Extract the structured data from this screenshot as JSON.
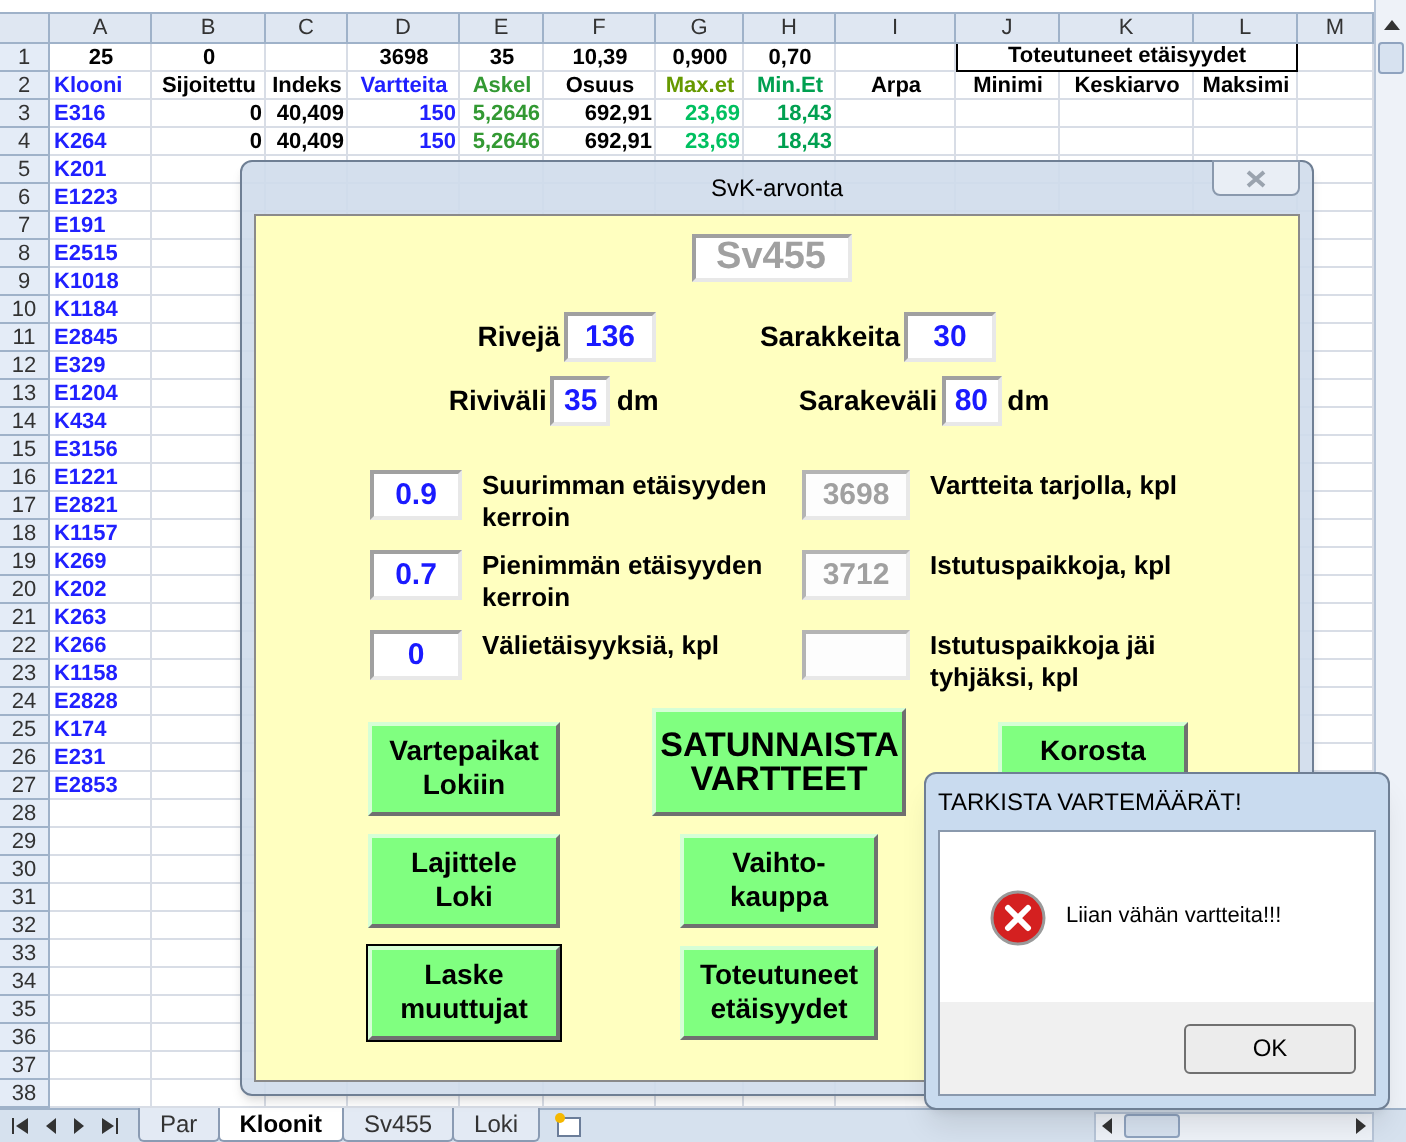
{
  "sheet": {
    "column_headers": [
      "A",
      "B",
      "C",
      "D",
      "E",
      "F",
      "G",
      "H",
      "I",
      "J",
      "K",
      "L",
      "M"
    ],
    "rows": [
      {
        "number": "1",
        "cells": [
          {
            "text": "25",
            "color": "#000000"
          },
          {
            "text": "0",
            "color": "#000000"
          },
          null,
          {
            "text": "3698",
            "color": "#000000"
          },
          {
            "text": "35",
            "color": "#000000"
          },
          {
            "text": "10,39",
            "color": "#000000"
          },
          {
            "text": "0,900",
            "color": "#000000"
          },
          {
            "text": "0,70",
            "color": "#000000"
          },
          null
        ],
        "merged_cell": "Toteutuneet etäisyydet"
      },
      {
        "number": "2",
        "cells": [
          {
            "text": "Klooni",
            "color": "#2020ff"
          },
          {
            "text": "Sijoitettu",
            "color": "#000000"
          },
          {
            "text": "Indeks",
            "color": "#000000"
          },
          {
            "text": "Vartteita",
            "color": "#2020ff"
          },
          {
            "text": "Askel",
            "color": "#339933"
          },
          {
            "text": "Osuus",
            "color": "#000000"
          },
          {
            "text": "Max.et",
            "color": "#669900"
          },
          {
            "text": "Min.Et",
            "color": "#00a050"
          },
          {
            "text": "Arpa",
            "color": "#000000"
          },
          {
            "text": "Minimi",
            "color": "#000000"
          },
          {
            "text": "Keskiarvo",
            "color": "#000000"
          },
          {
            "text": "Maksimi",
            "color": "#000000"
          }
        ]
      },
      {
        "number": "3",
        "cells": [
          {
            "text": "E316",
            "color": "#2020ff"
          },
          {
            "text": "0",
            "color": "#000000"
          },
          {
            "text": "40,409",
            "color": "#000000"
          },
          {
            "text": "150",
            "color": "#2020ff"
          },
          {
            "text": "5,2646",
            "color": "#339933"
          },
          {
            "text": "692,91",
            "color": "#000000"
          },
          {
            "text": "23,69",
            "color": "#00c060"
          },
          {
            "text": "18,43",
            "color": "#00a050"
          }
        ]
      },
      {
        "number": "4",
        "cells": [
          {
            "text": "K264",
            "color": "#2020ff"
          },
          {
            "text": "0",
            "color": "#000000"
          },
          {
            "text": "40,409",
            "color": "#000000"
          },
          {
            "text": "150",
            "color": "#2020ff"
          },
          {
            "text": "5,2646",
            "color": "#339933"
          },
          {
            "text": "692,91",
            "color": "#000000"
          },
          {
            "text": "23,69",
            "color": "#00c060"
          },
          {
            "text": "18,43",
            "color": "#00a050"
          }
        ]
      },
      {
        "number": "5",
        "cells": [
          {
            "text": "K201",
            "color": "#2020ff"
          }
        ]
      },
      {
        "number": "6",
        "cells": [
          {
            "text": "E1223",
            "color": "#2020ff"
          }
        ]
      },
      {
        "number": "7",
        "cells": [
          {
            "text": "E191",
            "color": "#2020ff"
          }
        ]
      },
      {
        "number": "8",
        "cells": [
          {
            "text": "E2515",
            "color": "#2020ff"
          }
        ]
      },
      {
        "number": "9",
        "cells": [
          {
            "text": "K1018",
            "color": "#2020ff"
          }
        ]
      },
      {
        "number": "10",
        "cells": [
          {
            "text": "K1184",
            "color": "#2020ff"
          }
        ]
      },
      {
        "number": "11",
        "cells": [
          {
            "text": "E2845",
            "color": "#2020ff"
          }
        ]
      },
      {
        "number": "12",
        "cells": [
          {
            "text": "E329",
            "color": "#2020ff"
          }
        ]
      },
      {
        "number": "13",
        "cells": [
          {
            "text": "E1204",
            "color": "#2020ff"
          }
        ]
      },
      {
        "number": "14",
        "cells": [
          {
            "text": "K434",
            "color": "#2020ff"
          }
        ]
      },
      {
        "number": "15",
        "cells": [
          {
            "text": "E3156",
            "color": "#2020ff"
          }
        ]
      },
      {
        "number": "16",
        "cells": [
          {
            "text": "E1221",
            "color": "#2020ff"
          }
        ]
      },
      {
        "number": "17",
        "cells": [
          {
            "text": "E2821",
            "color": "#2020ff"
          }
        ]
      },
      {
        "number": "18",
        "cells": [
          {
            "text": "K1157",
            "color": "#2020ff"
          }
        ]
      },
      {
        "number": "19",
        "cells": [
          {
            "text": "K269",
            "color": "#2020ff"
          }
        ]
      },
      {
        "number": "20",
        "cells": [
          {
            "text": "K202",
            "color": "#2020ff"
          }
        ]
      },
      {
        "number": "21",
        "cells": [
          {
            "text": "K263",
            "color": "#2020ff"
          }
        ]
      },
      {
        "number": "22",
        "cells": [
          {
            "text": "K266",
            "color": "#2020ff"
          }
        ]
      },
      {
        "number": "23",
        "cells": [
          {
            "text": "K1158",
            "color": "#2020ff"
          }
        ]
      },
      {
        "number": "24",
        "cells": [
          {
            "text": "E2828",
            "color": "#2020ff"
          }
        ]
      },
      {
        "number": "25",
        "cells": [
          {
            "text": "K174",
            "color": "#2020ff"
          }
        ]
      },
      {
        "number": "26",
        "cells": [
          {
            "text": "E231",
            "color": "#2020ff"
          }
        ]
      },
      {
        "number": "27",
        "cells": [
          {
            "text": "E2853",
            "color": "#2020ff"
          }
        ]
      },
      {
        "number": "28",
        "cells": []
      },
      {
        "number": "29",
        "cells": []
      },
      {
        "number": "30",
        "cells": []
      },
      {
        "number": "31",
        "cells": []
      },
      {
        "number": "32",
        "cells": []
      },
      {
        "number": "33",
        "cells": []
      },
      {
        "number": "34",
        "cells": []
      },
      {
        "number": "35",
        "cells": []
      },
      {
        "number": "36",
        "cells": []
      },
      {
        "number": "37",
        "cells": []
      },
      {
        "number": "38",
        "cells": []
      }
    ],
    "tabs": [
      {
        "label": "Par",
        "selected": false
      },
      {
        "label": "Kloonit",
        "selected": true
      },
      {
        "label": "Sv455",
        "selected": false
      },
      {
        "label": "Loki",
        "selected": false
      }
    ]
  },
  "dialog": {
    "title": "SvK-arvonta",
    "sheet_name": "Sv455",
    "grid_fields": [
      {
        "label": "Rivejä",
        "value": "136"
      },
      {
        "label": "Sarakkeita",
        "value": "30"
      },
      {
        "label": "Riviväli",
        "value": "35",
        "unit": "dm"
      },
      {
        "label": "Sarakeväli",
        "value": "80",
        "unit": "dm"
      }
    ],
    "factor_rows": [
      [
        {
          "value": "0.9",
          "label": "Suurimman etäisyyden kerroin",
          "disabled": false
        },
        {
          "value": "3698",
          "label": "Vartteita tarjolla, kpl",
          "disabled": true
        }
      ],
      [
        {
          "value": "0.7",
          "label": "Pienimmän etäisyyden kerroin",
          "disabled": false
        },
        {
          "value": "3712",
          "label": "Istutuspaikkoja, kpl",
          "disabled": true
        }
      ],
      [
        {
          "value": "0",
          "label": "Välietäisyyksiä, kpl",
          "disabled": false
        },
        {
          "label": "Istutuspaikkoja jäi tyhjäksi, kpl",
          "disabled": true
        }
      ]
    ],
    "button_columns": [
      [
        {
          "label": "Vartepaikat Lokiin",
          "kind": "normal",
          "focused": false
        },
        {
          "label": "Lajittele Loki",
          "kind": "normal",
          "focused": false
        },
        {
          "label": "Laske muuttujat",
          "kind": "normal",
          "focused": true
        }
      ],
      [
        {
          "label": "SATUNNAISTA VARTTEET",
          "kind": "large",
          "focused": false
        },
        {
          "label": "Vaihto-kauppa",
          "kind": "normal",
          "focused": false
        },
        {
          "label": "Toteutuneet etäisyydet",
          "kind": "normal",
          "focused": false
        }
      ],
      [
        {
          "label": "Korosta",
          "kind": "normal",
          "focused": false
        }
      ]
    ]
  },
  "message_box": {
    "title": "TARKISTA VARTEMÄÄRÄT!",
    "message": "Liian vähän vartteita!!!",
    "button": "OK"
  }
}
